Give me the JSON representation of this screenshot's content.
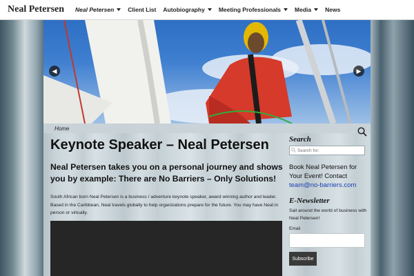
{
  "site": {
    "brand": "Neal Petersen"
  },
  "nav": {
    "items": [
      {
        "label": "Neal Petersen",
        "dropdown": true,
        "active": true
      },
      {
        "label": "Client List",
        "dropdown": false
      },
      {
        "label": "Autobiography",
        "dropdown": true
      },
      {
        "label": "Meeting Professionals",
        "dropdown": true
      },
      {
        "label": "Media",
        "dropdown": true
      },
      {
        "label": "News",
        "dropdown": false
      }
    ]
  },
  "slider": {
    "prev_icon": "chevron-left-icon",
    "next_icon": "chevron-right-icon"
  },
  "breadcrumb": {
    "home": "Home"
  },
  "main": {
    "title": "Keynote Speaker – Neal Petersen",
    "subhead": "Neal Petersen takes you on a personal journey and shows you by example: There are No Barriers – Only Solutions!",
    "intro": "South African born Neal Petersen is a business / adventure keynote speaker, award winning author and leader. Based in the Caribbean, Neal travels globally to help organizations prepare for the future. You may have Neal in person or virtually."
  },
  "sidebar": {
    "search_heading": "Search",
    "search_placeholder": "Search for:",
    "book_text": "Book Neal Petersen for Your Event! Contact",
    "book_email": "team@no-barriers.com",
    "newsletter_heading": "E-Newsletter",
    "newsletter_text": "Sail around the world of business with Neal Petersen!",
    "email_label": "Email",
    "subscribe_label": "Subscribe"
  },
  "colors": {
    "link": "#1a3fb0",
    "button": "#3a3a3a",
    "video": "#262626"
  }
}
